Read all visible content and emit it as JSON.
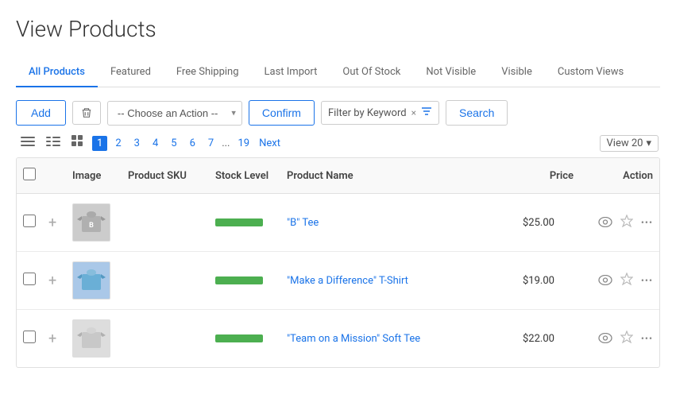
{
  "page": {
    "title": "View Products"
  },
  "tabs": [
    {
      "label": "All Products",
      "active": true
    },
    {
      "label": "Featured",
      "active": false
    },
    {
      "label": "Free Shipping",
      "active": false
    },
    {
      "label": "Last Import",
      "active": false
    },
    {
      "label": "Out Of Stock",
      "active": false
    },
    {
      "label": "Not Visible",
      "active": false
    },
    {
      "label": "Visible",
      "active": false
    },
    {
      "label": "Custom Views",
      "active": false
    }
  ],
  "toolbar": {
    "add_label": "Add",
    "confirm_label": "Confirm",
    "search_label": "Search",
    "choose_action_placeholder": "-- Choose an Action --",
    "filter_keyword": "Filter by Keyword"
  },
  "pagination": {
    "pages": [
      "1",
      "2",
      "3",
      "4",
      "5",
      "6",
      "7",
      "...",
      "19"
    ],
    "current": "1",
    "next_label": "Next",
    "view_label": "View 20"
  },
  "table": {
    "headers": [
      "",
      "",
      "Image",
      "Product SKU",
      "Stock Level",
      "Product Name",
      "Price",
      "Action"
    ],
    "rows": [
      {
        "id": 1,
        "sku": "",
        "stock_level": "high",
        "product_name": "\"B\" Tee",
        "price": "$25.00",
        "tee_type": "b"
      },
      {
        "id": 2,
        "sku": "",
        "stock_level": "high",
        "product_name": "\"Make a Difference\" T-Shirt",
        "price": "$19.00",
        "tee_type": "blue"
      },
      {
        "id": 3,
        "sku": "",
        "stock_level": "high",
        "product_name": "\"Team on a Mission\" Soft Tee",
        "price": "$22.00",
        "tee_type": "gray"
      }
    ]
  },
  "icons": {
    "delete": "🗑",
    "eye": "👁",
    "star": "☆",
    "more": "•••",
    "list_view1": "≡",
    "list_view2": "☰",
    "grid_view": "⊞",
    "chevron_down": "▾",
    "filter_funnel": "⊟",
    "close": "×"
  },
  "colors": {
    "accent": "#1a73e8",
    "stock_green": "#4caf50",
    "border": "#e0e0e0"
  }
}
